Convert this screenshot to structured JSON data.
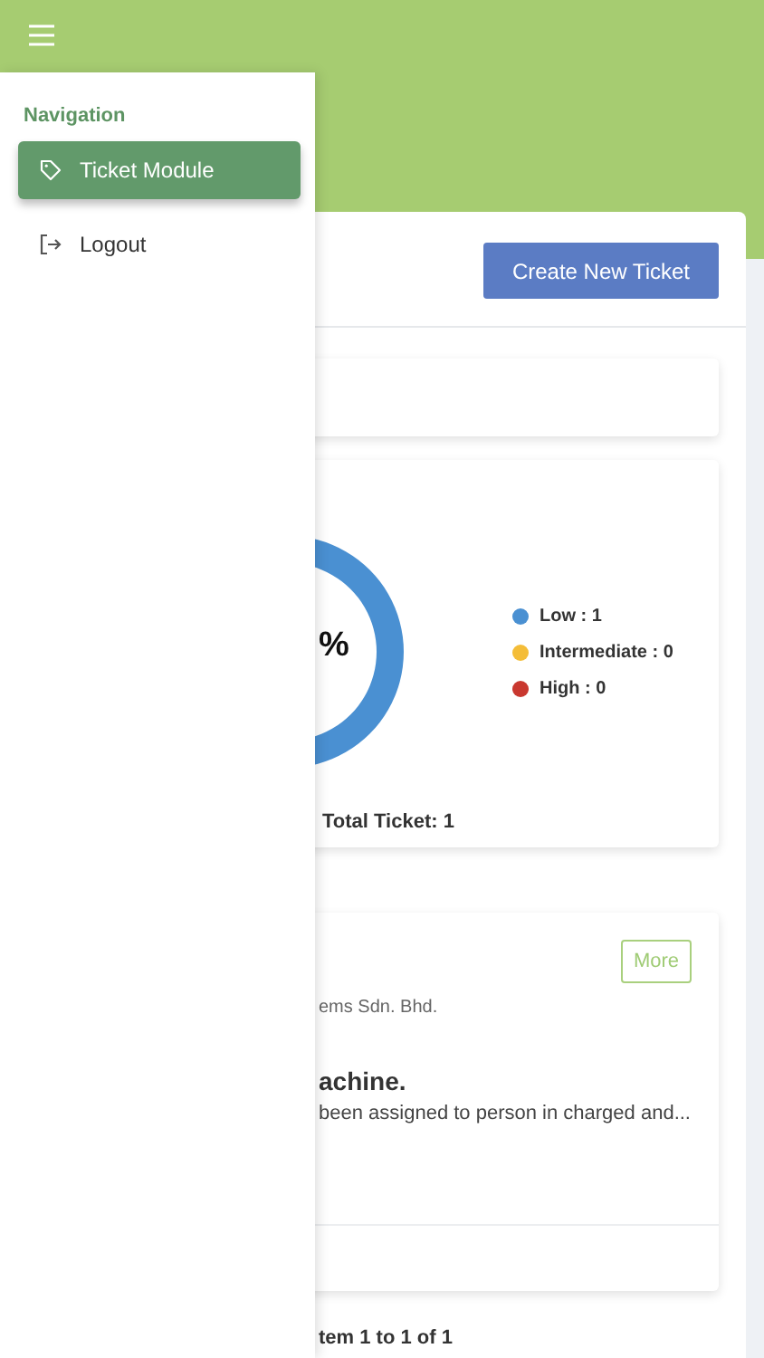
{
  "drawer": {
    "heading": "Navigation",
    "items": [
      {
        "label": "Ticket Module",
        "kind": "tag",
        "selected": true
      },
      {
        "label": "Logout",
        "kind": "logout",
        "selected": false
      }
    ]
  },
  "toolbar": {
    "create_button": "Create New Ticket"
  },
  "summary": {
    "center_label": "%",
    "legend": [
      {
        "label": "Low : 1",
        "color": "#4a90d2"
      },
      {
        "label": "Intermediate : 0",
        "color": "#f4bd38"
      },
      {
        "label": "High : 0",
        "color": "#c9382f"
      }
    ],
    "total": "Total Ticket: 1"
  },
  "ticket": {
    "button": "More",
    "company": "ems Sdn. Bhd.",
    "title": "achine.",
    "description": "been assigned to person in charged and..."
  },
  "pagination": "tem 1 to 1 of 1"
}
